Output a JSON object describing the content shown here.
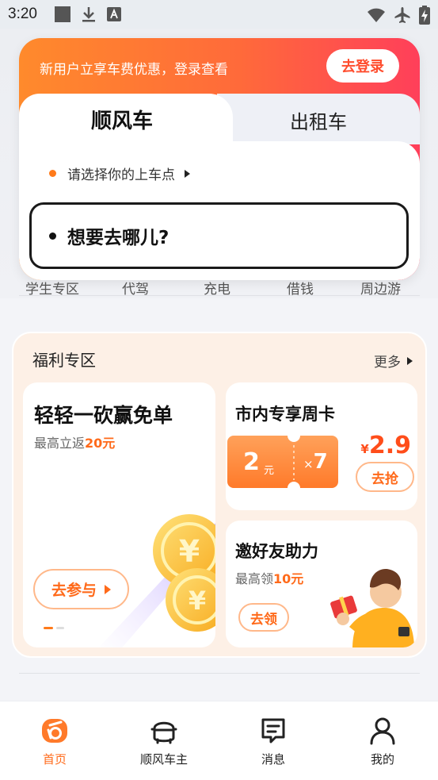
{
  "status_bar": {
    "time": "3:20",
    "left_icons": [
      "square-icon",
      "download-icon",
      "font-a-icon"
    ],
    "right_icons": [
      "wifi-icon",
      "airplane-icon",
      "battery-charging-icon"
    ]
  },
  "top_card": {
    "promo_text": "新用户立享车费优惠，登录查看",
    "login_label": "去登录",
    "tabs": [
      {
        "label": "顺风车",
        "active": true
      },
      {
        "label": "出租车",
        "active": false
      }
    ],
    "pickup_label": "请选择你的上车点",
    "destination_placeholder": "想要去哪儿?"
  },
  "services": [
    "学生专区",
    "代驾",
    "充电",
    "借钱",
    "周边游"
  ],
  "welfare": {
    "title": "福利专区",
    "more_label": "更多",
    "bargain_card": {
      "title": "轻轻一砍赢免单",
      "subtitle_prefix": "最高立返",
      "subtitle_amount": "20元",
      "button_label": "去参与"
    },
    "weekly_card": {
      "title": "市内专享周卡",
      "coupon_amount": "2",
      "coupon_unit": "元",
      "coupon_times_sign": "×",
      "coupon_times": "7",
      "currency": "¥",
      "price": "2.9",
      "button_label": "去抢"
    },
    "invite_card": {
      "title": "邀好友助力",
      "subtitle_prefix": "最高领",
      "subtitle_amount": "10元",
      "button_label": "去领"
    }
  },
  "bottom_nav": [
    {
      "label": "首页",
      "icon": "home-icon",
      "active": true
    },
    {
      "label": "顺风车主",
      "icon": "car-icon",
      "active": false
    },
    {
      "label": "消息",
      "icon": "message-icon",
      "active": false
    },
    {
      "label": "我的",
      "icon": "profile-icon",
      "active": false
    }
  ],
  "colors": {
    "accent": "#ff6a1a",
    "gradient_start": "#ff8a2c",
    "gradient_end": "#ff3f5a",
    "welfare_bg": "#fdf0e6"
  }
}
